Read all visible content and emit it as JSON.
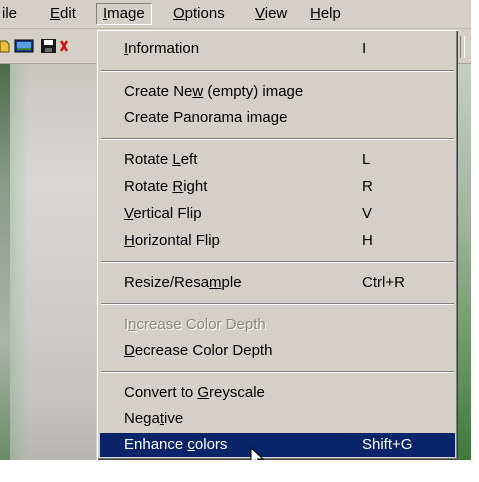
{
  "menubar": {
    "items": [
      {
        "id": "file",
        "label": "File",
        "visible_text": "ile"
      },
      {
        "id": "edit",
        "label": "Edit",
        "accel": "E",
        "rest": "dit"
      },
      {
        "id": "image",
        "label": "Image",
        "accel": "I",
        "rest": "mage"
      },
      {
        "id": "options",
        "label": "Options",
        "accel": "O",
        "rest": "ptions"
      },
      {
        "id": "view",
        "label": "View",
        "accel": "V",
        "rest": "iew"
      },
      {
        "id": "help",
        "label": "Help",
        "accel": "H",
        "rest": "elp"
      }
    ]
  },
  "image_menu": {
    "information": {
      "pre": "",
      "accel": "I",
      "post": "nformation",
      "shortcut": "I"
    },
    "create_new": {
      "pre": "Create Ne",
      "accel": "w",
      "post": " (empty) image",
      "shortcut": ""
    },
    "create_panorama": {
      "pre": "Create Panorama image",
      "accel": "",
      "post": "",
      "shortcut": ""
    },
    "rotate_left": {
      "pre": "Rotate ",
      "accel": "L",
      "post": "eft",
      "shortcut": "L"
    },
    "rotate_right": {
      "pre": "Rotate ",
      "accel": "R",
      "post": "ight",
      "shortcut": "R"
    },
    "vertical_flip": {
      "pre": "",
      "accel": "V",
      "post": "ertical Flip",
      "shortcut": "V"
    },
    "horizontal_flip": {
      "pre": "",
      "accel": "H",
      "post": "orizontal Flip",
      "shortcut": "H"
    },
    "resize": {
      "pre": "Resize/Resa",
      "accel": "m",
      "post": "ple",
      "shortcut": "Ctrl+R"
    },
    "increase_depth": {
      "pre": "I",
      "accel": "n",
      "post": "crease Color Depth",
      "shortcut": ""
    },
    "decrease_depth": {
      "pre": "",
      "accel": "D",
      "post": "ecrease Color Depth",
      "shortcut": ""
    },
    "greyscale": {
      "pre": "Convert to ",
      "accel": "G",
      "post": "reyscale",
      "shortcut": ""
    },
    "negative": {
      "pre": "Nega",
      "accel": "t",
      "post": "ive",
      "shortcut": ""
    },
    "enhance_colors": {
      "pre": "Enhance ",
      "accel": "c",
      "post": "olors",
      "shortcut": "Shift+G"
    }
  },
  "colors": {
    "menu_bg": "#d4d0c8",
    "highlight": "#0a246a",
    "disabled_text": "#8a8782"
  },
  "icons": [
    "open-icon",
    "thumbnail-icon",
    "save-icon",
    "close-icon"
  ]
}
